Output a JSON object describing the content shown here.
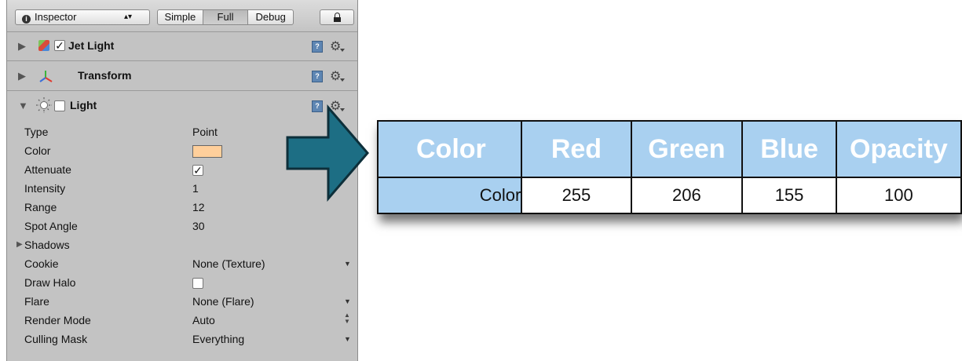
{
  "inspector": {
    "tab_label": "Inspector",
    "modes": [
      "Simple",
      "Full",
      "Debug"
    ],
    "active_mode": "Full"
  },
  "components": {
    "gameobject": {
      "name": "Jet Light",
      "enabled": true
    },
    "transform": {
      "name": "Transform"
    },
    "light": {
      "name": "Light",
      "enabled": false
    }
  },
  "light_props": [
    {
      "label": "Type",
      "value": "Point"
    },
    {
      "label": "Color",
      "value": ""
    },
    {
      "label": "Attenuate",
      "value": ""
    },
    {
      "label": "Intensity",
      "value": "1"
    },
    {
      "label": "Range",
      "value": "12"
    },
    {
      "label": "Spot Angle",
      "value": "30"
    },
    {
      "label": "Shadows",
      "value": ""
    },
    {
      "label": "Cookie",
      "value": "None (Texture)"
    },
    {
      "label": "Draw Halo",
      "value": ""
    },
    {
      "label": "Flare",
      "value": "None (Flare)"
    },
    {
      "label": "Render Mode",
      "value": "Auto"
    },
    {
      "label": "Culling Mask",
      "value": "Everything"
    }
  ],
  "color_swatch_hex": "#ffcf9b",
  "attenuate_checked": true,
  "draw_halo_checked": false,
  "table": {
    "headers": [
      "Color",
      "Red",
      "Green",
      "Blue",
      "Opacity"
    ],
    "row": [
      "Color",
      "255",
      "206",
      "155",
      "100"
    ]
  },
  "colors": {
    "panel_bg": "#c3c3c3",
    "table_header_bg": "#a9d0f0",
    "arrow_fill": "#1d6e84"
  }
}
